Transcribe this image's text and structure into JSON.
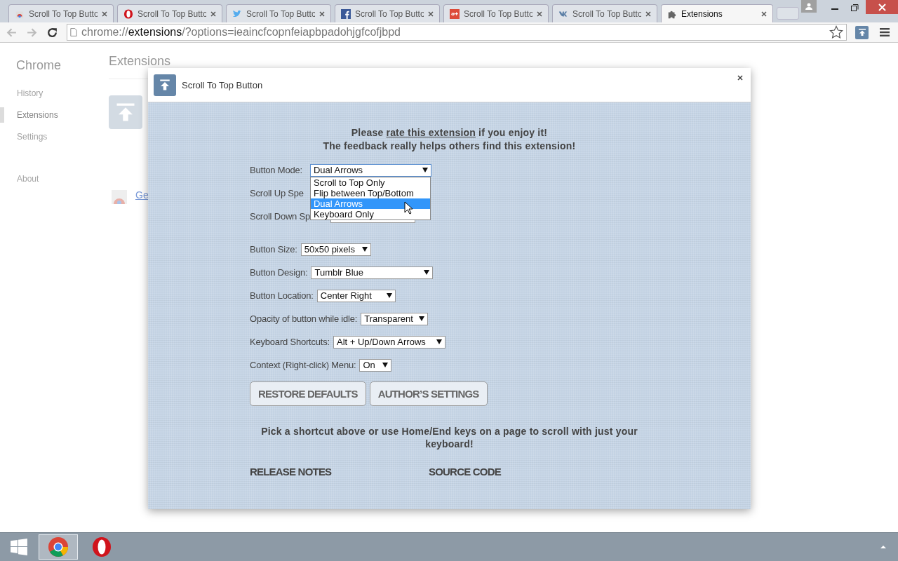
{
  "tabs": [
    {
      "title": "Scroll To Top Butto",
      "selected": false
    },
    {
      "title": "Scroll To Top Butto",
      "selected": false
    },
    {
      "title": "Scroll To Top Butto",
      "selected": false
    },
    {
      "title": "Scroll To Top Butto",
      "selected": false
    },
    {
      "title": "Scroll To Top Butto",
      "selected": false
    },
    {
      "title": "Scroll To Top Butto",
      "selected": false
    },
    {
      "title": "Extensions",
      "selected": true
    }
  ],
  "address": {
    "scheme": "chrome://",
    "host": "extensions",
    "path": "/?options=ieaincfcopnfeiapbpadohjgfcofjbpd"
  },
  "background_page": {
    "brand": "Chrome",
    "nav": [
      {
        "label": "History",
        "selected": false
      },
      {
        "label": "Extensions",
        "selected": true
      },
      {
        "label": "Settings",
        "selected": false
      },
      {
        "label": "About",
        "selected": false
      }
    ],
    "heading": "Extensions",
    "link": "Ge"
  },
  "dialog": {
    "title": "Scroll To Top Button",
    "notice": {
      "before": "Please ",
      "link": "rate this extension",
      "after": " if you enjoy it!",
      "line2": "The feedback really helps others find this extension!"
    },
    "settings": [
      {
        "kind": "open",
        "label": "Button Mode:",
        "value": "Dual Arrows",
        "options": [
          {
            "label": "Scroll to Top Only",
            "selected": false
          },
          {
            "label": "Flip between Top/Bottom",
            "selected": false
          },
          {
            "label": "Dual Arrows",
            "selected": true
          },
          {
            "label": "Keyboard Only",
            "selected": false
          }
        ]
      },
      {
        "kind": "covered",
        "label": "Scroll Up Spe"
      },
      {
        "kind": "hidden_value",
        "label": "Scroll Down Sp"
      },
      {
        "kind": "select",
        "label": "Button Size:",
        "value": "50x50 pixels"
      },
      {
        "kind": "select",
        "label": "Button Design:",
        "value": "Tumblr Blue"
      },
      {
        "kind": "select",
        "label": "Button Location:",
        "value": "Center Right"
      },
      {
        "kind": "select",
        "label": "Opacity of button while idle:",
        "value": "Transparent"
      },
      {
        "kind": "select",
        "label": "Keyboard Shortcuts:",
        "value": "Alt + Up/Down Arrows"
      },
      {
        "kind": "select",
        "label": "Context (Right-click) Menu:",
        "value": "On"
      }
    ],
    "buttons": [
      "RESTORE DEFAULTS",
      "AUTHOR’S SETTINGS"
    ],
    "tip": "Pick a shortcut above or use Home/End keys on a page to scroll with just your keyboard!",
    "links": [
      "RELEASE NOTES",
      "SOURCE CODE"
    ]
  }
}
